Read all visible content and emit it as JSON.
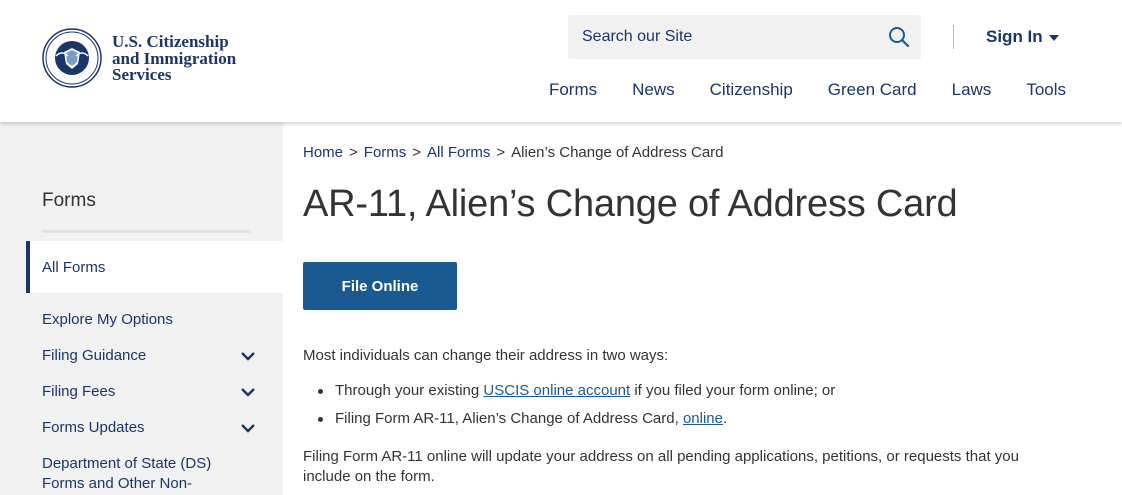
{
  "header": {
    "logo_lines": [
      "U.S. Citizenship",
      "and Immigration",
      "Services"
    ],
    "seal_icon": "dhs-seal-icon",
    "search": {
      "placeholder": "Search our Site",
      "icon": "search-icon"
    },
    "signin_label": "Sign In",
    "nav": [
      "Forms",
      "News",
      "Citizenship",
      "Green Card",
      "Laws",
      "Tools"
    ]
  },
  "sidebar": {
    "title": "Forms",
    "active_item": "All Forms",
    "items": [
      {
        "label": "Explore My Options",
        "expandable": false
      },
      {
        "label": "Filing Guidance",
        "expandable": true
      },
      {
        "label": "Filing Fees",
        "expandable": true
      },
      {
        "label": "Forms Updates",
        "expandable": true
      },
      {
        "label": "Department of State (DS) Forms and Other Non-",
        "expandable": false
      }
    ]
  },
  "breadcrumb": {
    "items": [
      "Home",
      "Forms",
      "All Forms"
    ],
    "separator": ">",
    "current": "Alien’s Change of Address Card"
  },
  "main": {
    "title": "AR-11, Alien’s Change of Address Card",
    "file_online_button": "File Online",
    "intro": "Most individuals can change their address in two ways:",
    "bullet1": {
      "before": "Through your existing ",
      "link": "USCIS online account",
      "after": " if you filed your form online; or"
    },
    "bullet2": {
      "before": "Filing Form AR-11, Alien’s Change of Address Card, ",
      "link": "online",
      "after": "."
    },
    "paragraph2": "Filing Form AR-11 online will update your address on all pending applications, petitions, or requests that you include on the form."
  },
  "colors": {
    "brand_navy": "#1a3668",
    "button_blue": "#1a5a91",
    "sidebar_bg": "#f1f1f1"
  }
}
